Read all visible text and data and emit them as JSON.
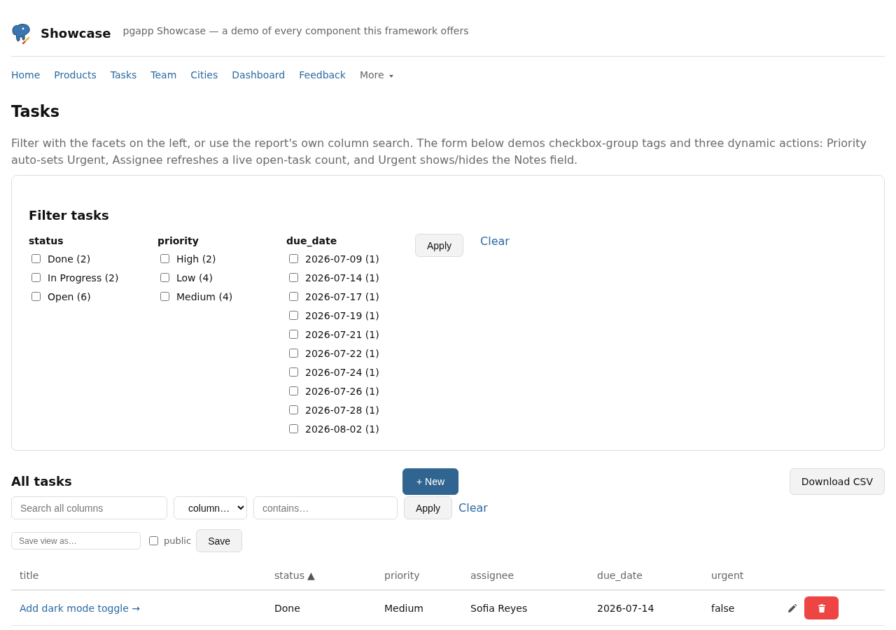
{
  "header": {
    "app_name": "Showcase",
    "tagline": "pgapp Showcase — a demo of every component this framework offers"
  },
  "nav": [
    {
      "label": "Home",
      "kind": "link"
    },
    {
      "label": "Products",
      "kind": "link"
    },
    {
      "label": "Tasks",
      "kind": "link"
    },
    {
      "label": "Team",
      "kind": "link"
    },
    {
      "label": "Cities",
      "kind": "link"
    },
    {
      "label": "Dashboard",
      "kind": "link"
    },
    {
      "label": "Feedback",
      "kind": "link"
    },
    {
      "label": "More",
      "kind": "dropdown"
    }
  ],
  "page": {
    "title": "Tasks",
    "description": "Filter with the facets on the left, or use the report's own column search. The form below demos checkbox-group tags and three dynamic actions: Priority auto-sets Urgent, Assignee refreshes a live open-task count, and Urgent shows/hides the Notes field."
  },
  "filter_panel": {
    "title": "Filter tasks",
    "facets": [
      {
        "name": "status",
        "options": [
          {
            "label": "Done (2)",
            "checked": false
          },
          {
            "label": "In Progress (2)",
            "checked": false
          },
          {
            "label": "Open (6)",
            "checked": false
          }
        ]
      },
      {
        "name": "priority",
        "options": [
          {
            "label": "High (2)",
            "checked": false
          },
          {
            "label": "Low (4)",
            "checked": false
          },
          {
            "label": "Medium (4)",
            "checked": false
          }
        ]
      },
      {
        "name": "due_date",
        "options": [
          {
            "label": "2026-07-09 (1)",
            "checked": false
          },
          {
            "label": "2026-07-14 (1)",
            "checked": false
          },
          {
            "label": "2026-07-17 (1)",
            "checked": false
          },
          {
            "label": "2026-07-19 (1)",
            "checked": false
          },
          {
            "label": "2026-07-21 (1)",
            "checked": false
          },
          {
            "label": "2026-07-22 (1)",
            "checked": false
          },
          {
            "label": "2026-07-24 (1)",
            "checked": false
          },
          {
            "label": "2026-07-26 (1)",
            "checked": false
          },
          {
            "label": "2026-07-28 (1)",
            "checked": false
          },
          {
            "label": "2026-08-02 (1)",
            "checked": false
          }
        ]
      }
    ],
    "apply_button": "Apply",
    "clear_link": "Clear"
  },
  "report": {
    "title": "All tasks",
    "new_button": "+ New",
    "download_button": "Download CSV",
    "search": {
      "placeholder": "Search all columns"
    },
    "column_select": {
      "value": "column…"
    },
    "contains": {
      "placeholder": "contains…"
    },
    "apply_button": "Apply",
    "clear_link": "Clear",
    "save_view": {
      "placeholder": "Save view as…",
      "public": {
        "label": "public",
        "checked": false
      },
      "save_button": "Save"
    },
    "table": {
      "columns": [
        {
          "label": "title"
        },
        {
          "label": "status",
          "sort_mark": "▲"
        },
        {
          "label": "priority"
        },
        {
          "label": "assignee"
        },
        {
          "label": "due_date"
        },
        {
          "label": "urgent"
        }
      ],
      "rows": [
        {
          "cells": [
            {
              "kind": "link",
              "text": "Add dark mode toggle →"
            },
            {
              "kind": "text",
              "text": "Done"
            },
            {
              "kind": "text",
              "text": "Medium"
            },
            {
              "kind": "text",
              "text": "Sofia Reyes"
            },
            {
              "kind": "text",
              "text": "2026-07-14"
            },
            {
              "kind": "text",
              "text": "false"
            }
          ]
        }
      ]
    }
  }
}
